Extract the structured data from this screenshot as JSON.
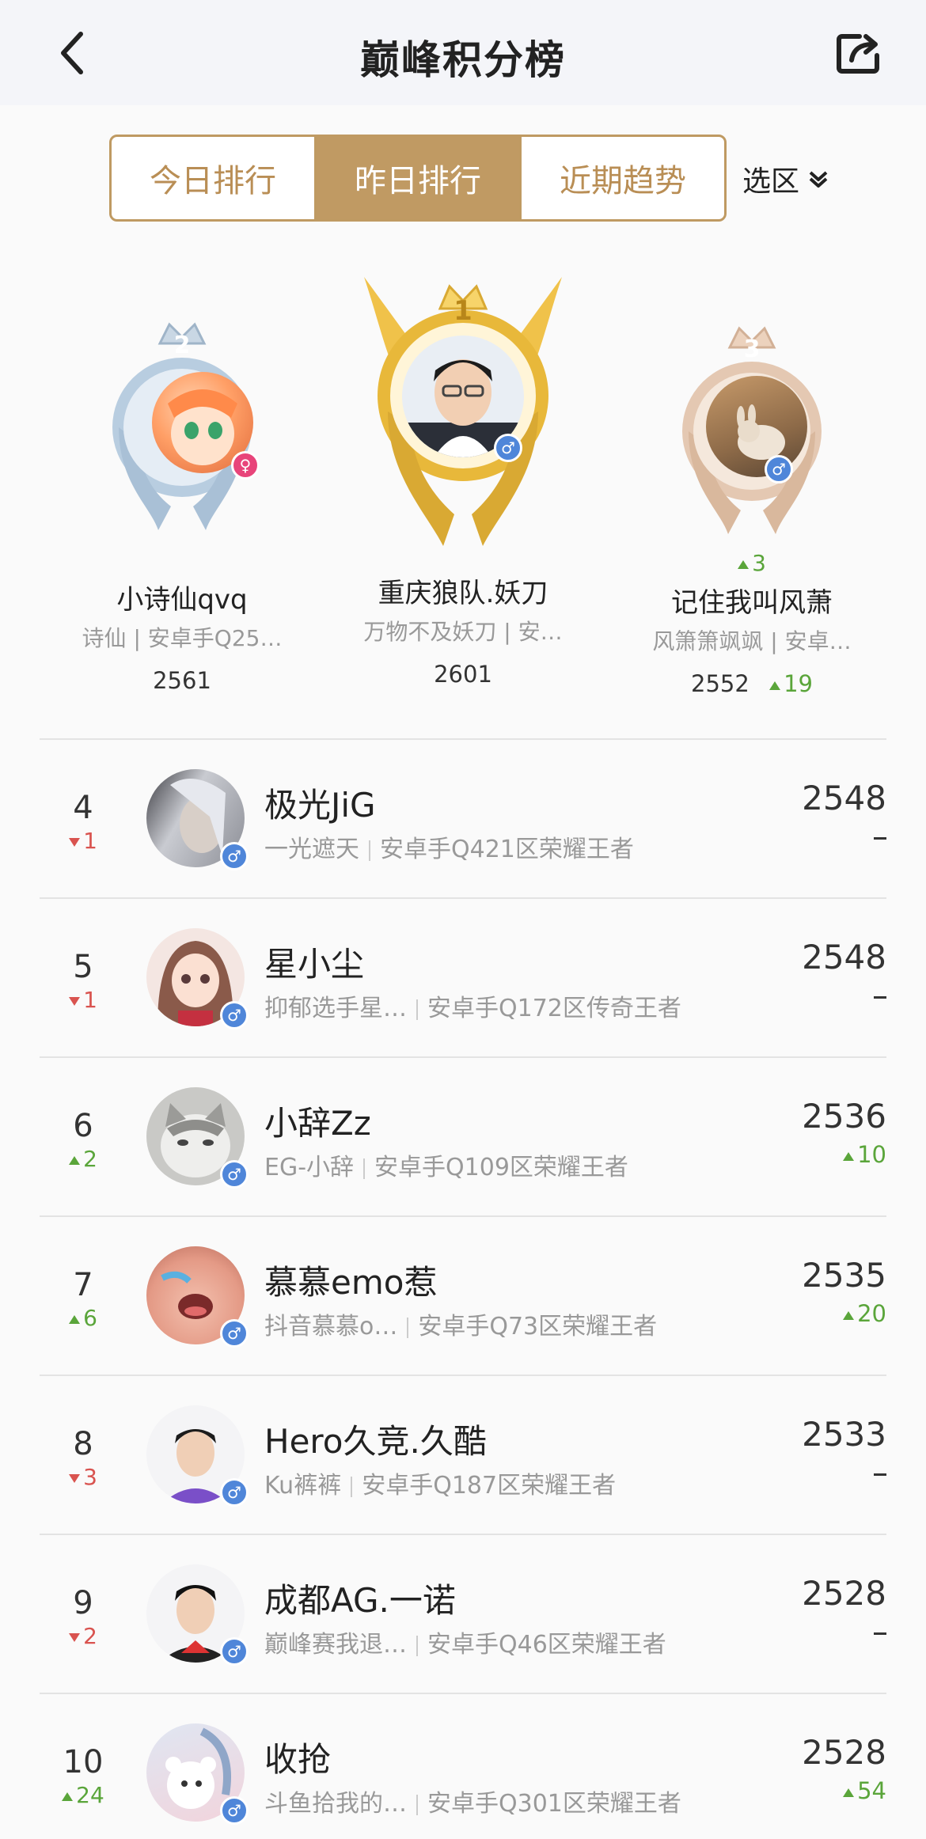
{
  "header": {
    "title": "巅峰积分榜"
  },
  "tabs": [
    {
      "label": "今日排行",
      "active": false
    },
    {
      "label": "昨日排行",
      "active": true
    },
    {
      "label": "近期趋势",
      "active": false
    }
  ],
  "region": {
    "label": "选区"
  },
  "podium": [
    {
      "rank": "2",
      "name": "小诗仙qvq",
      "sub": "诗仙 | 安卓手Q25…",
      "score": "2561",
      "gender": "female",
      "rank_change": "",
      "score_change": ""
    },
    {
      "rank": "1",
      "name": "重庆狼队.妖刀",
      "sub": "万物不及妖刀 | 安…",
      "score": "2601",
      "gender": "male",
      "rank_change": "",
      "score_change": ""
    },
    {
      "rank": "3",
      "name": "记住我叫风萧",
      "sub": "风箫箫飒飒 | 安卓…",
      "score": "2552",
      "gender": "male",
      "rank_change": "3",
      "score_change": "19"
    }
  ],
  "rows": [
    {
      "rank": "4",
      "change": "1",
      "dir": "down",
      "name": "极光JiG",
      "nick": "一光遮天",
      "server": "安卓手Q421区荣耀王者",
      "score": "2548",
      "trend": "",
      "trend_dir": "none"
    },
    {
      "rank": "5",
      "change": "1",
      "dir": "down",
      "name": "星小尘",
      "nick": "抑郁选手星…",
      "server": "安卓手Q172区传奇王者",
      "score": "2548",
      "trend": "",
      "trend_dir": "none"
    },
    {
      "rank": "6",
      "change": "2",
      "dir": "up",
      "name": "小辞Zz",
      "nick": "EG-小辞",
      "server": "安卓手Q109区荣耀王者",
      "score": "2536",
      "trend": "10",
      "trend_dir": "up"
    },
    {
      "rank": "7",
      "change": "6",
      "dir": "up",
      "name": "慕慕emo惹",
      "nick": "抖音慕慕o…",
      "server": "安卓手Q73区荣耀王者",
      "score": "2535",
      "trend": "20",
      "trend_dir": "up"
    },
    {
      "rank": "8",
      "change": "3",
      "dir": "down",
      "name": "Hero久竞.久酷",
      "nick": "Ku裤裤",
      "server": "安卓手Q187区荣耀王者",
      "score": "2533",
      "trend": "",
      "trend_dir": "none"
    },
    {
      "rank": "9",
      "change": "2",
      "dir": "down",
      "name": "成都AG.一诺",
      "nick": "巅峰赛我退…",
      "server": "安卓手Q46区荣耀王者",
      "score": "2528",
      "trend": "",
      "trend_dir": "none"
    },
    {
      "rank": "10",
      "change": "24",
      "dir": "up",
      "name": "收抢",
      "nick": "斗鱼拾我的…",
      "server": "安卓手Q301区荣耀王者",
      "score": "2528",
      "trend": "54",
      "trend_dir": "up"
    }
  ],
  "colors": {
    "accent": "#c09a63",
    "up": "#5aa53a",
    "down": "#d9534f",
    "male": "#4f86d9",
    "female": "#e8447a"
  }
}
